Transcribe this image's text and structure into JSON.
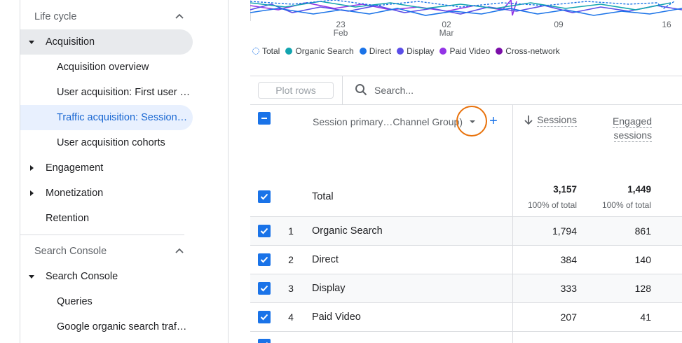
{
  "sidebar": {
    "section1": "Life cycle",
    "acquisition": "Acquisition",
    "acq_items": [
      "Acquisition overview",
      "User acquisition: First user …",
      "Traffic acquisition: Session…",
      "User acquisition cohorts"
    ],
    "engagement": "Engagement",
    "monetization": "Monetization",
    "retention": "Retention",
    "section2": "Search Console",
    "search_console": "Search Console",
    "sc_items": [
      "Queries",
      "Google organic search traf…"
    ]
  },
  "chart": {
    "ticks": [
      {
        "day": "23",
        "month": "Feb"
      },
      {
        "day": "02",
        "month": "Mar"
      },
      {
        "day": "09",
        "month": ""
      },
      {
        "day": "16",
        "month": ""
      }
    ],
    "legend": [
      {
        "label": "Total",
        "color": "#1a73e8"
      },
      {
        "label": "Organic Search",
        "color": "#12a4af"
      },
      {
        "label": "Direct",
        "color": "#1a73e8"
      },
      {
        "label": "Display",
        "color": "#5b4ee8"
      },
      {
        "label": "Paid Video",
        "color": "#9334e6"
      },
      {
        "label": "Cross-network",
        "color": "#7b0ea8"
      }
    ]
  },
  "toolbar": {
    "plot_rows": "Plot rows",
    "search_placeholder": "Search..."
  },
  "table": {
    "dimension_header": "Session primary…Channel Group)",
    "col_sessions": "Sessions",
    "col_engaged": "Engaged sessions",
    "total": {
      "label": "Total",
      "sessions": "3,157",
      "sessions_pct": "100% of total",
      "engaged": "1,449",
      "engaged_pct": "100% of total"
    },
    "rows": [
      {
        "rank": "1",
        "channel": "Organic Search",
        "sessions": "1,794",
        "engaged": "861"
      },
      {
        "rank": "2",
        "channel": "Direct",
        "sessions": "384",
        "engaged": "140"
      },
      {
        "rank": "3",
        "channel": "Display",
        "sessions": "333",
        "engaged": "128"
      },
      {
        "rank": "4",
        "channel": "Paid Video",
        "sessions": "207",
        "engaged": "41"
      }
    ]
  }
}
